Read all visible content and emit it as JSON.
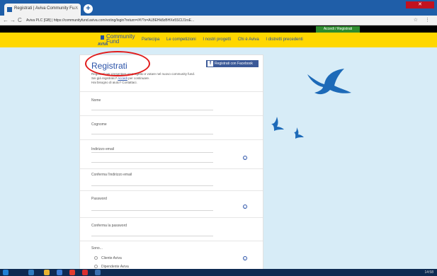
{
  "browser": {
    "tab_title": "Registrati | Aviva Community Fu...",
    "tab_close": "×",
    "new_tab": "+",
    "url": "Aviva PLC [GB] | https://communityfund.aviva.com/voting/login?return=/#!/?s=ALBEHk8zBHXe5SClJ1rsE...",
    "nav_back": "←",
    "nav_forward": "→",
    "nav_reload": "C"
  },
  "header": {
    "access_label": "Accedi / Registrati",
    "logo_community": "Community",
    "logo_fund": "Fund",
    "logo_brand": "AVIVA",
    "nav": [
      "Partecipa",
      "Le competizioni",
      "I nostri progetti",
      "Chi è Aviva",
      "I distretti precedenti"
    ]
  },
  "form": {
    "title": "Registrati",
    "intro_line1": "Registrati per presentare un progetto e votare nel nuovo community fund.",
    "intro_line2_prefix": "Sei già registrato?",
    "intro_link": "Accedi",
    "intro_line2_suffix": " per continuare.",
    "intro_line3": "Hai bisogno di aiuto? Contattaci.",
    "facebook_label": "Registrati con Facebook",
    "facebook_icon": "f",
    "fields": [
      {
        "label": "Nome"
      },
      {
        "label": "Cognome"
      },
      {
        "label": "Indirizzo email"
      },
      {
        "label": "Conferma l'indirizzo email"
      },
      {
        "label": "Password"
      },
      {
        "label": "Conferma la password"
      }
    ],
    "role_label": "Sono...",
    "role_options": [
      "Cliente Aviva",
      "Dipendente Aviva"
    ],
    "info_symbol": "i"
  },
  "taskbar": {
    "clock": "14:58"
  },
  "colors": {
    "brand_yellow": "#ffd700",
    "brand_blue": "#2a52a8",
    "access_green": "#2e8b2e",
    "facebook_blue": "#3b5998",
    "highlight_red": "#e11b1b"
  }
}
